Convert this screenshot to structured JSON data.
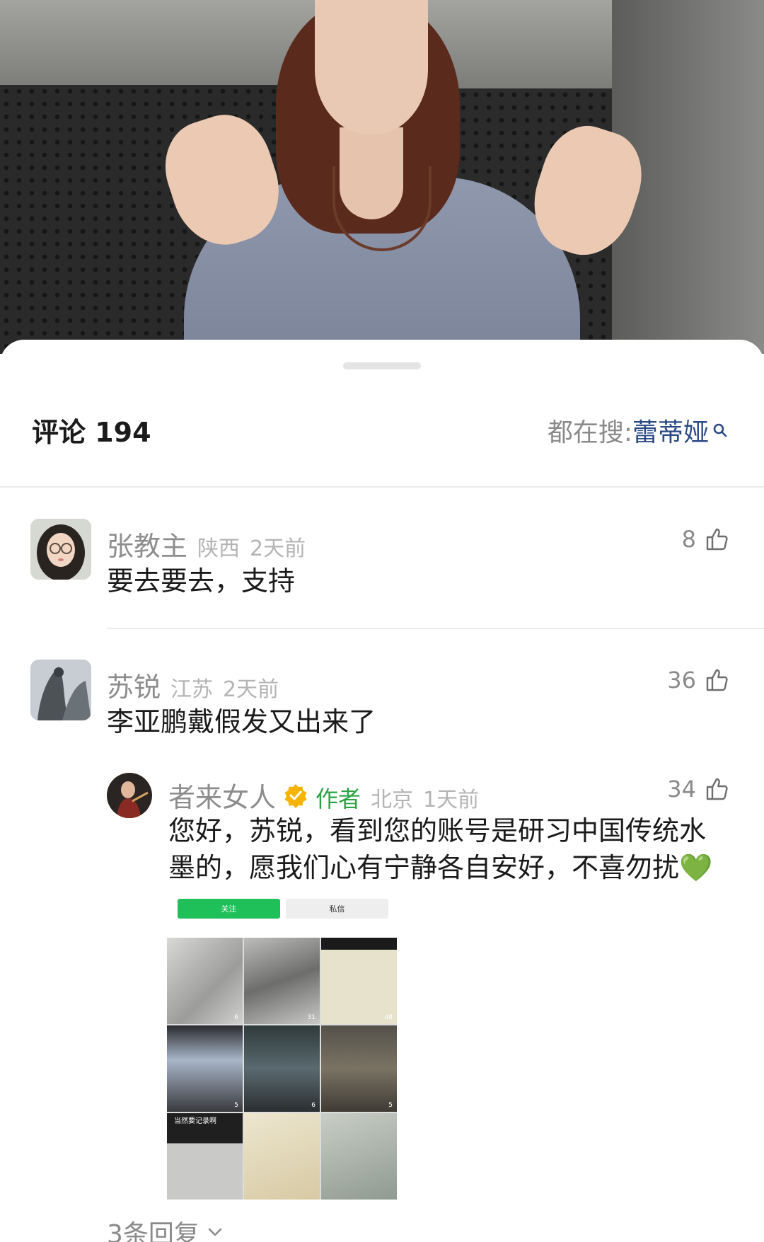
{
  "header": {
    "comment_label": "评论 194",
    "search_prefix": "都在搜:",
    "search_keyword": "蕾蒂娅"
  },
  "comments": [
    {
      "name": "张教主",
      "location": "陕西",
      "time": "2天前",
      "text": "要去要去，支持",
      "likes": "8"
    },
    {
      "name": "苏锐",
      "location": "江苏",
      "time": "2天前",
      "text": "李亚鹏戴假发又出来了",
      "likes": "36"
    }
  ],
  "reply": {
    "name": "者来女人",
    "author_badge": "作者",
    "location": "北京",
    "time": "1天前",
    "text_line1": "您好，苏锐，看到您的账号是研习中国传统水",
    "text_line2": "墨的，愿我们心有宁静各自安好，不喜勿扰💚",
    "likes": "34"
  },
  "embed": {
    "follow_label": "关注",
    "message_label": "私信",
    "counts": [
      "6",
      "31",
      "48",
      "5",
      "6",
      "5"
    ],
    "caption": "当然要记录啊"
  },
  "replies_link": "3条回复",
  "colors": {
    "author_green": "#2ba245",
    "keyword_blue": "#2b4a84",
    "follow_green": "#1fbf5a"
  }
}
